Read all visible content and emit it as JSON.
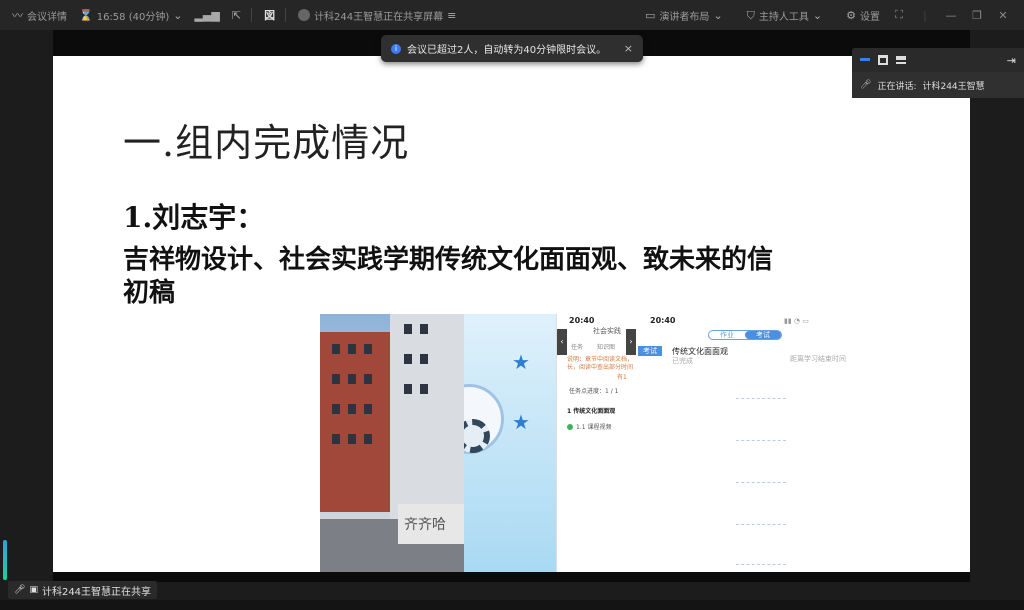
{
  "topbar": {
    "meeting_details": "会议详情",
    "timer": "16:58 (40分钟)",
    "sharing_status": "计科244王智慧正在共享屏幕",
    "speaker_layout": "演讲者布局",
    "host_tools": "主持人工具",
    "settings": "设置"
  },
  "toast": {
    "message": "会议已超过2人，自动转为40分钟限时会议。",
    "close": "×"
  },
  "speaker_panel": {
    "speaking_label": "正在讲话:",
    "speaking_name": "计科244王智慧"
  },
  "slide": {
    "title": "一.组内完成情况",
    "subtitle": "1.刘志宇：",
    "paragraph_line1": "吉祥物设计、社会实践学期传统文化面面观、致未来的信",
    "paragraph_line2": "初稿"
  },
  "collage": {
    "gate_text": "齐齐哈",
    "phone1": {
      "time": "20:40",
      "header": "社会实践",
      "tab_task": "任务",
      "tab_knowledge": "知识图",
      "desc": "说明：章节中阅读文档，长，阅读中查出部分时间",
      "more": "有1",
      "progress": "任务点进度：1 / 1",
      "section": "1 传统文化面面观",
      "item": "1.1 课程视频"
    },
    "phone2": {
      "time": "20:40",
      "tab_homework": "作业",
      "tab_exam": "考试",
      "badge": "考试",
      "title": "传统文化面面观",
      "sub": "已完成",
      "hint": "距离学习结束时间"
    }
  },
  "bottom": {
    "sharing_tag": "计科244王智慧正在共享"
  },
  "colors": {
    "accent": "#3d7bf0",
    "background": "#1c1c1c"
  }
}
